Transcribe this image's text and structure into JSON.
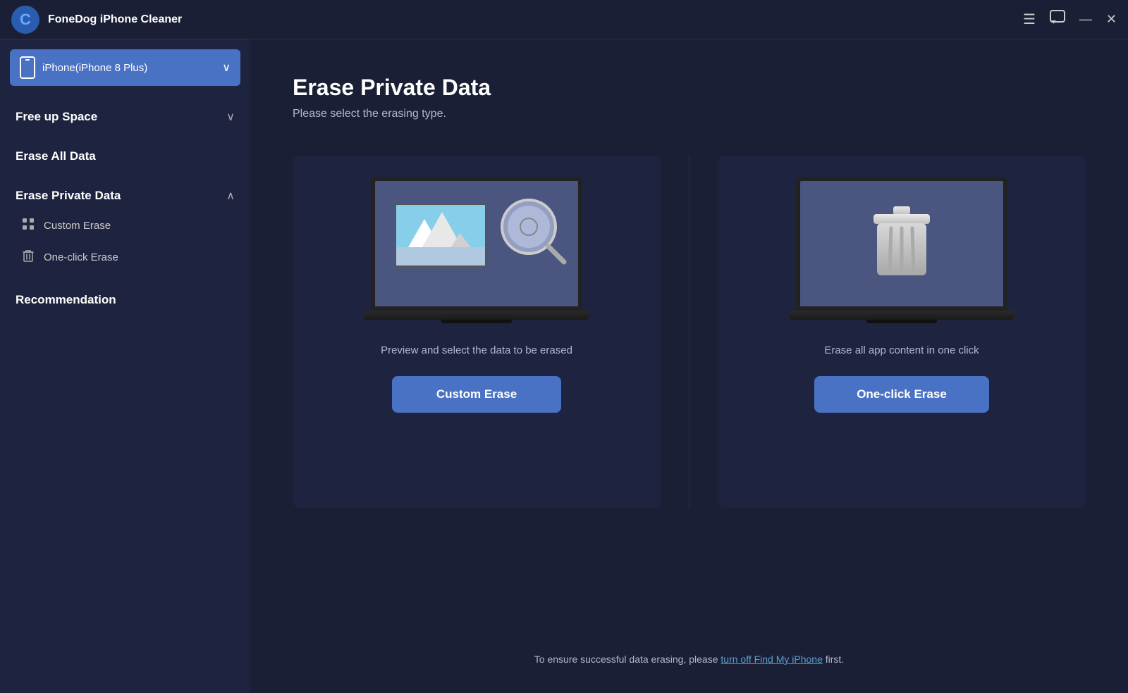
{
  "app": {
    "title": "FoneDog iPhone Cleaner",
    "logo_letter": "C"
  },
  "titlebar": {
    "menu_icon": "☰",
    "chat_icon": "💬",
    "minimize_icon": "—",
    "close_icon": "✕"
  },
  "device_selector": {
    "label": "iPhone(iPhone 8 Plus)",
    "chevron": "∨"
  },
  "sidebar": {
    "free_up_space": "Free up Space",
    "erase_all_data": "Erase All Data",
    "erase_private_data": "Erase Private Data",
    "custom_erase": "Custom Erase",
    "one_click_erase": "One-click Erase",
    "recommendation": "Recommendation"
  },
  "main": {
    "page_title": "Erase Private Data",
    "page_subtitle": "Please select the erasing type.",
    "custom_card": {
      "description": "Preview and select the data to be erased",
      "button_label": "Custom Erase"
    },
    "oneclick_card": {
      "description": "Erase all app content in one click",
      "button_label": "One-click Erase"
    },
    "footer": {
      "text_before_link": "To ensure successful data erasing, please ",
      "link_text": "turn off Find My iPhone",
      "text_after_link": " first."
    }
  }
}
